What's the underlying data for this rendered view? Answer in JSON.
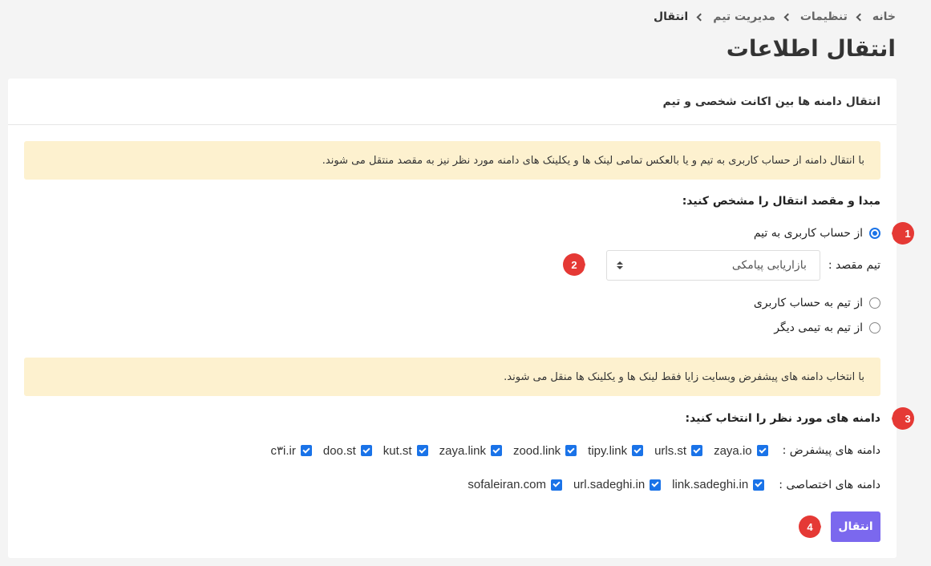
{
  "breadcrumb": [
    {
      "label": "خانه"
    },
    {
      "label": "تنظیمات"
    },
    {
      "label": "مدیریت تیم"
    },
    {
      "label": "انتقال"
    }
  ],
  "page_title": "انتقال اطلاعات",
  "card": {
    "header": "انتقال دامنه ها بین اکانت شخصی و تیم",
    "alert_1": "با انتقال دامنه از حساب کاربری به تیم و یا بالعکس تمامی لینک ها و یکلینک های دامنه مورد نظر نیز به مقصد منتقل می شوند.",
    "source_label": "مبدا و مقصد انتقال را مشخص کنید:",
    "options": [
      {
        "label": "از حساب کاربری به تیم",
        "checked": true
      },
      {
        "label": "از تیم به حساب کاربری",
        "checked": false
      },
      {
        "label": "از تیم به تیمی دیگر",
        "checked": false
      }
    ],
    "target_team_label": "تیم مقصد :",
    "target_team_value": "بازاریابی پیامکی",
    "alert_2": "با انتخاب دامنه های پیشفرض وبسایت زایا فقط لینک ها و یکلینک ها منقل می شوند.",
    "domains_label": "دامنه های مورد نظر را انتخاب کنید:",
    "default_domains_label": "دامنه های پیشفرض :",
    "default_domains": [
      "zaya.io",
      "urls.st",
      "tipy.link",
      "zood.link",
      "zaya.link",
      "kut.st",
      "doo.st",
      "c۳i.ir"
    ],
    "custom_domains_label": "دامنه های اختصاصی :",
    "custom_domains": [
      "link.sadeghi.in",
      "url.sadeghi.in",
      "sofaleiran.com"
    ],
    "submit_label": "انتقال"
  },
  "markers": [
    "1",
    "2",
    "3",
    "4"
  ],
  "colors": {
    "accent": "#7b68ee",
    "checkbox": "#1a73e8",
    "alert_bg": "#fdf1cf",
    "marker": "#e53935"
  }
}
